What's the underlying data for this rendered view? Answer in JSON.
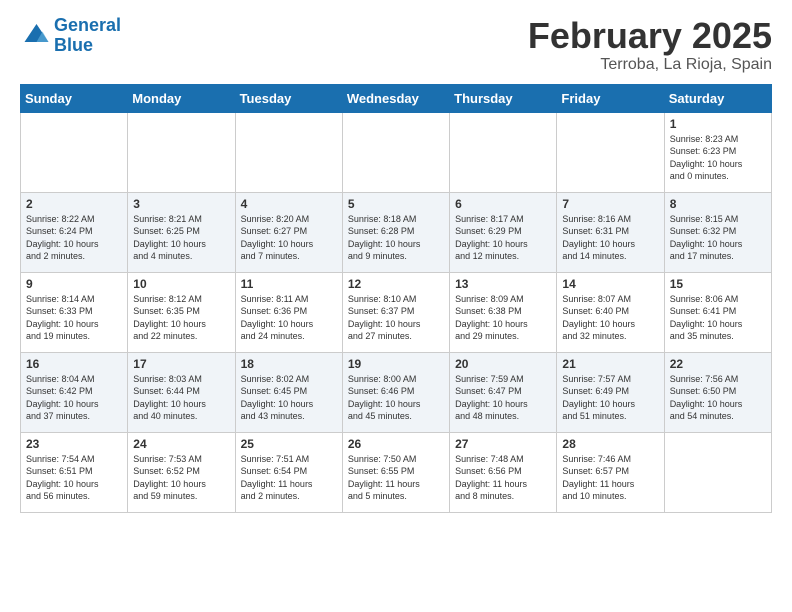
{
  "logo": {
    "line1": "General",
    "line2": "Blue"
  },
  "title": "February 2025",
  "subtitle": "Terroba, La Rioja, Spain",
  "days_of_week": [
    "Sunday",
    "Monday",
    "Tuesday",
    "Wednesday",
    "Thursday",
    "Friday",
    "Saturday"
  ],
  "weeks": [
    [
      {
        "day": "",
        "text": ""
      },
      {
        "day": "",
        "text": ""
      },
      {
        "day": "",
        "text": ""
      },
      {
        "day": "",
        "text": ""
      },
      {
        "day": "",
        "text": ""
      },
      {
        "day": "",
        "text": ""
      },
      {
        "day": "1",
        "text": "Sunrise: 8:23 AM\nSunset: 6:23 PM\nDaylight: 10 hours\nand 0 minutes."
      }
    ],
    [
      {
        "day": "2",
        "text": "Sunrise: 8:22 AM\nSunset: 6:24 PM\nDaylight: 10 hours\nand 2 minutes."
      },
      {
        "day": "3",
        "text": "Sunrise: 8:21 AM\nSunset: 6:25 PM\nDaylight: 10 hours\nand 4 minutes."
      },
      {
        "day": "4",
        "text": "Sunrise: 8:20 AM\nSunset: 6:27 PM\nDaylight: 10 hours\nand 7 minutes."
      },
      {
        "day": "5",
        "text": "Sunrise: 8:18 AM\nSunset: 6:28 PM\nDaylight: 10 hours\nand 9 minutes."
      },
      {
        "day": "6",
        "text": "Sunrise: 8:17 AM\nSunset: 6:29 PM\nDaylight: 10 hours\nand 12 minutes."
      },
      {
        "day": "7",
        "text": "Sunrise: 8:16 AM\nSunset: 6:31 PM\nDaylight: 10 hours\nand 14 minutes."
      },
      {
        "day": "8",
        "text": "Sunrise: 8:15 AM\nSunset: 6:32 PM\nDaylight: 10 hours\nand 17 minutes."
      }
    ],
    [
      {
        "day": "9",
        "text": "Sunrise: 8:14 AM\nSunset: 6:33 PM\nDaylight: 10 hours\nand 19 minutes."
      },
      {
        "day": "10",
        "text": "Sunrise: 8:12 AM\nSunset: 6:35 PM\nDaylight: 10 hours\nand 22 minutes."
      },
      {
        "day": "11",
        "text": "Sunrise: 8:11 AM\nSunset: 6:36 PM\nDaylight: 10 hours\nand 24 minutes."
      },
      {
        "day": "12",
        "text": "Sunrise: 8:10 AM\nSunset: 6:37 PM\nDaylight: 10 hours\nand 27 minutes."
      },
      {
        "day": "13",
        "text": "Sunrise: 8:09 AM\nSunset: 6:38 PM\nDaylight: 10 hours\nand 29 minutes."
      },
      {
        "day": "14",
        "text": "Sunrise: 8:07 AM\nSunset: 6:40 PM\nDaylight: 10 hours\nand 32 minutes."
      },
      {
        "day": "15",
        "text": "Sunrise: 8:06 AM\nSunset: 6:41 PM\nDaylight: 10 hours\nand 35 minutes."
      }
    ],
    [
      {
        "day": "16",
        "text": "Sunrise: 8:04 AM\nSunset: 6:42 PM\nDaylight: 10 hours\nand 37 minutes."
      },
      {
        "day": "17",
        "text": "Sunrise: 8:03 AM\nSunset: 6:44 PM\nDaylight: 10 hours\nand 40 minutes."
      },
      {
        "day": "18",
        "text": "Sunrise: 8:02 AM\nSunset: 6:45 PM\nDaylight: 10 hours\nand 43 minutes."
      },
      {
        "day": "19",
        "text": "Sunrise: 8:00 AM\nSunset: 6:46 PM\nDaylight: 10 hours\nand 45 minutes."
      },
      {
        "day": "20",
        "text": "Sunrise: 7:59 AM\nSunset: 6:47 PM\nDaylight: 10 hours\nand 48 minutes."
      },
      {
        "day": "21",
        "text": "Sunrise: 7:57 AM\nSunset: 6:49 PM\nDaylight: 10 hours\nand 51 minutes."
      },
      {
        "day": "22",
        "text": "Sunrise: 7:56 AM\nSunset: 6:50 PM\nDaylight: 10 hours\nand 54 minutes."
      }
    ],
    [
      {
        "day": "23",
        "text": "Sunrise: 7:54 AM\nSunset: 6:51 PM\nDaylight: 10 hours\nand 56 minutes."
      },
      {
        "day": "24",
        "text": "Sunrise: 7:53 AM\nSunset: 6:52 PM\nDaylight: 10 hours\nand 59 minutes."
      },
      {
        "day": "25",
        "text": "Sunrise: 7:51 AM\nSunset: 6:54 PM\nDaylight: 11 hours\nand 2 minutes."
      },
      {
        "day": "26",
        "text": "Sunrise: 7:50 AM\nSunset: 6:55 PM\nDaylight: 11 hours\nand 5 minutes."
      },
      {
        "day": "27",
        "text": "Sunrise: 7:48 AM\nSunset: 6:56 PM\nDaylight: 11 hours\nand 8 minutes."
      },
      {
        "day": "28",
        "text": "Sunrise: 7:46 AM\nSunset: 6:57 PM\nDaylight: 11 hours\nand 10 minutes."
      },
      {
        "day": "",
        "text": ""
      }
    ]
  ]
}
